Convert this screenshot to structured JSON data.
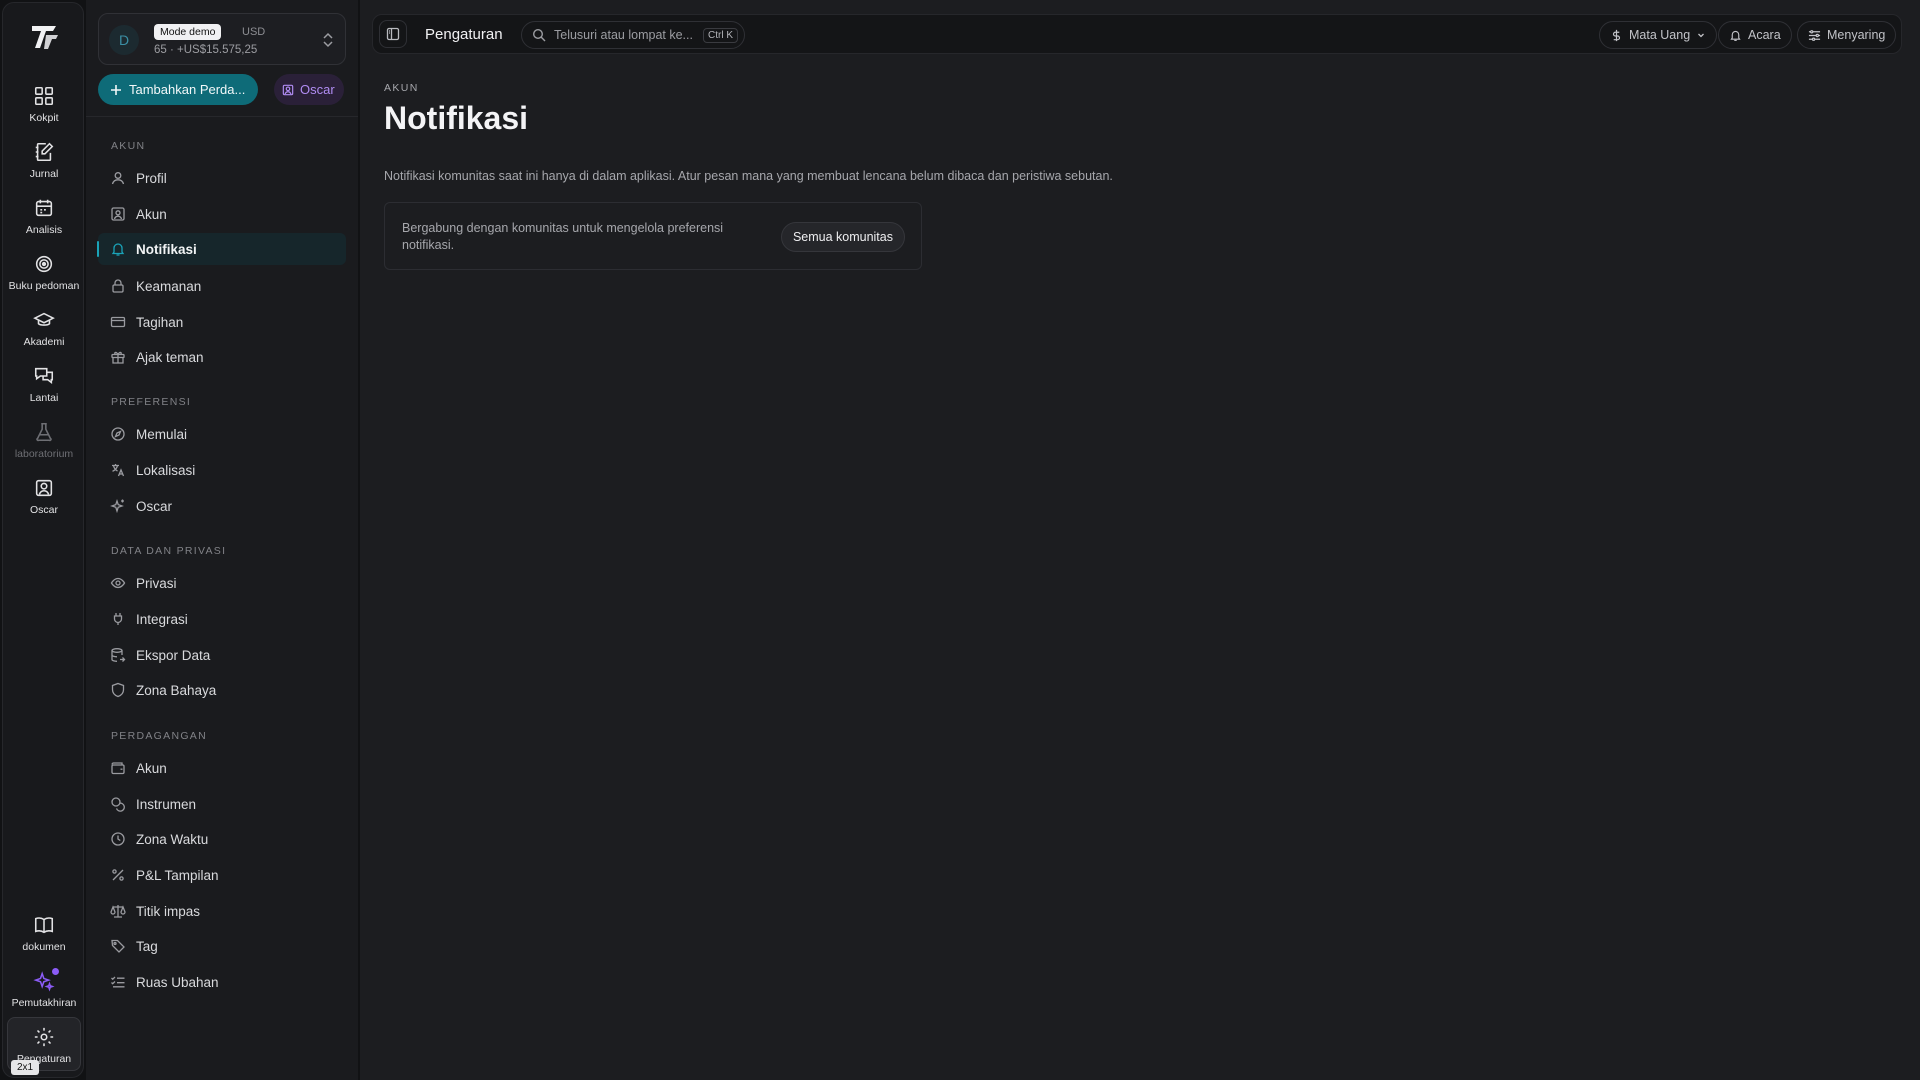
{
  "rail": {
    "items": [
      {
        "label": "Kokpit",
        "icon": "dashboard-icon"
      },
      {
        "label": "Jurnal",
        "icon": "journal-icon"
      },
      {
        "label": "Analisis",
        "icon": "calendar-icon"
      },
      {
        "label": "Buku pedoman",
        "icon": "target-icon"
      },
      {
        "label": "Akademi",
        "icon": "graduation-cap-icon"
      },
      {
        "label": "Lantai",
        "icon": "chat-icon"
      },
      {
        "label": "laboratorium",
        "icon": "flask-icon"
      },
      {
        "label": "Oscar",
        "icon": "contact-icon"
      }
    ],
    "bottom": [
      {
        "label": "dokumen",
        "icon": "book-icon"
      },
      {
        "label": "Pemutakhiran",
        "icon": "sparkle-icon"
      },
      {
        "label": "Pengaturan",
        "icon": "gear-icon"
      }
    ],
    "viewport_label": "2x1"
  },
  "account": {
    "avatar_letter": "D",
    "mode": "Mode demo",
    "currency": "USD",
    "balance": "65 · +US$15.575,25"
  },
  "actions": {
    "add_label": "Tambahkan Perda...",
    "oscar_label": "Oscar"
  },
  "sidebar": {
    "sections": [
      {
        "title": "AKUN",
        "items": [
          "Profil",
          "Akun",
          "Notifikasi",
          "Keamanan",
          "Tagihan",
          "Ajak teman"
        ]
      },
      {
        "title": "PREFERENSI",
        "items": [
          "Memulai",
          "Lokalisasi",
          "Oscar"
        ]
      },
      {
        "title": "DATA DAN PRIVASI",
        "items": [
          "Privasi",
          "Integrasi",
          "Ekspor Data",
          "Zona Bahaya"
        ]
      },
      {
        "title": "PERDAGANGAN",
        "items": [
          "Akun",
          "Instrumen",
          "Zona Waktu",
          "P&L Tampilan",
          "Titik impas",
          "Tag",
          "Ruas Ubahan"
        ]
      }
    ],
    "active": "Notifikasi"
  },
  "topbar": {
    "title": "Pengaturan",
    "search_placeholder": "Telusuri atau lompat ke...",
    "shortcut": "Ctrl K",
    "currency_label": "Mata Uang",
    "events_label": "Acara",
    "filter_label": "Menyaring"
  },
  "page": {
    "breadcrumb": "AKUN",
    "title": "Notifikasi",
    "description": "Notifikasi komunitas saat ini hanya di dalam aplikasi. Atur pesan mana yang membuat lencana belum dibaca dan peristiwa sebutan.",
    "card_text": "Bergabung dengan komunitas untuk mengelola preferensi notifikasi.",
    "card_button": "Semua komunitas"
  },
  "colors": {
    "accent": "#0e6b78",
    "active_indicator": "#1aa3b8",
    "oscar_purple": "#b08cf2"
  }
}
